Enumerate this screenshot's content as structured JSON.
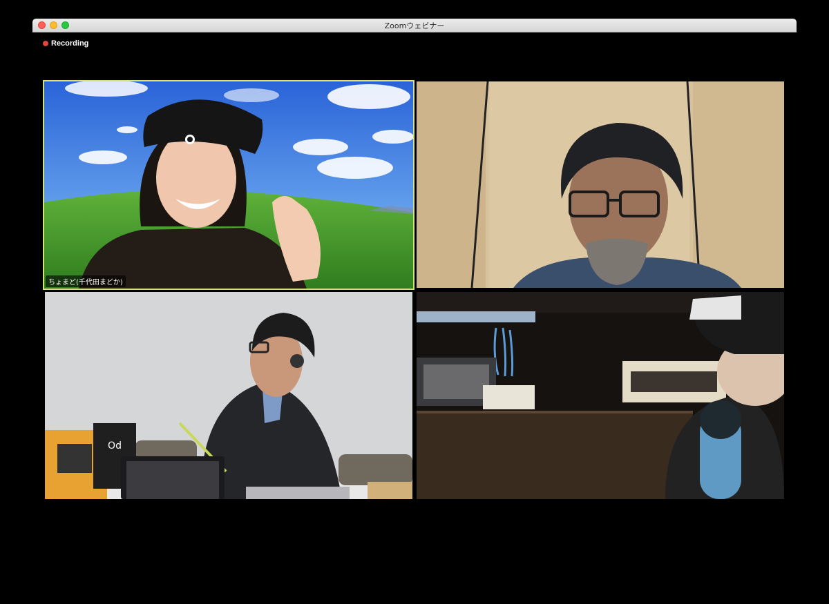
{
  "window": {
    "title": "Zoomウェビナー"
  },
  "recording": {
    "label": "Recording",
    "color": "#e0443e"
  },
  "participants": [
    {
      "name": "ちょまど(千代田まどか)",
      "active_speaker": true
    },
    {
      "name": ""
    },
    {
      "name": ""
    },
    {
      "name": ""
    }
  ],
  "colors": {
    "active_speaker_border": "#d6e27a"
  }
}
